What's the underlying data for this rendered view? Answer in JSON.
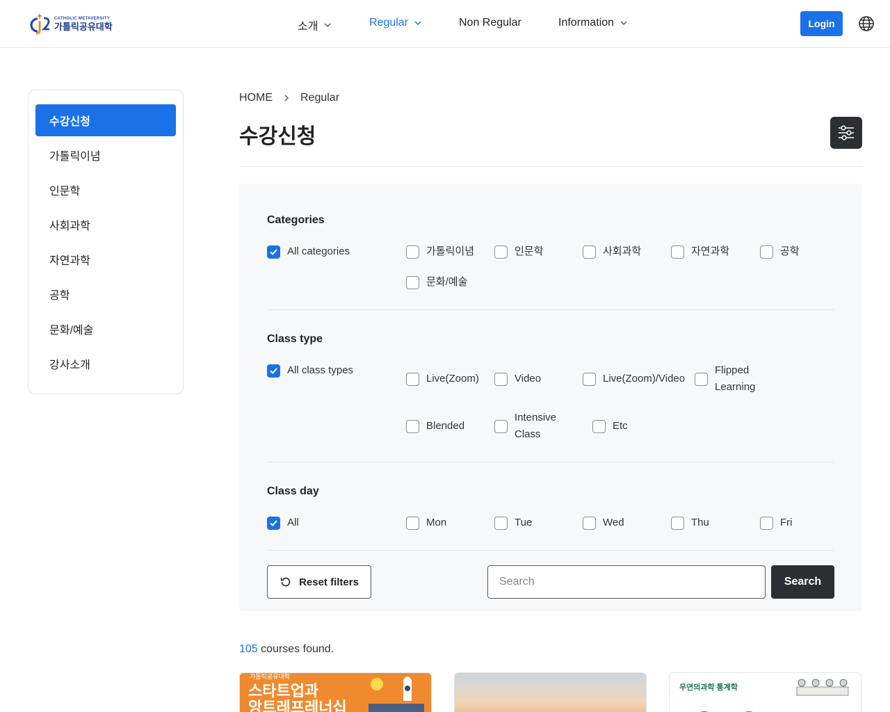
{
  "header": {
    "logo": {
      "tagline": "CATHOLIC METAVERSITY",
      "name": "가톨릭공유대학"
    },
    "nav": [
      {
        "label": "소개",
        "has_dropdown": true
      },
      {
        "label": "Regular",
        "has_dropdown": true,
        "active": true
      },
      {
        "label": "Non Regular",
        "has_dropdown": false
      },
      {
        "label": "Information",
        "has_dropdown": true
      }
    ],
    "login_label": "Login",
    "language_icon": "globe-icon"
  },
  "sidebar": {
    "items": [
      {
        "label": "수강신청",
        "active": true
      },
      {
        "label": "가톨릭이념"
      },
      {
        "label": "인문학"
      },
      {
        "label": "사회과학"
      },
      {
        "label": "자연과학"
      },
      {
        "label": "공학"
      },
      {
        "label": "문화/예술"
      },
      {
        "label": "강사소개"
      }
    ]
  },
  "breadcrumb": {
    "home": "HOME",
    "current": "Regular"
  },
  "page_title": "수강신청",
  "filters": {
    "categories": {
      "title": "Categories",
      "options": [
        {
          "label": "All categories",
          "checked": true
        },
        {
          "label": "가톨릭이념",
          "checked": false
        },
        {
          "label": "인문학",
          "checked": false
        },
        {
          "label": "사회과학",
          "checked": false
        },
        {
          "label": "자연과학",
          "checked": false
        },
        {
          "label": "공학",
          "checked": false
        },
        {
          "label": "문화/예술",
          "checked": false
        }
      ]
    },
    "class_type": {
      "title": "Class type",
      "options": [
        {
          "label": "All class types",
          "checked": true
        },
        {
          "label": "Live(Zoom)",
          "checked": false
        },
        {
          "label": "Video",
          "checked": false
        },
        {
          "label": "Live(Zoom)/Video",
          "checked": false
        },
        {
          "label": "Flipped Learning",
          "checked": false
        },
        {
          "label": "Blended",
          "checked": false
        },
        {
          "label": "Intensive Class",
          "checked": false
        },
        {
          "label": "Etc",
          "checked": false
        }
      ]
    },
    "class_day": {
      "title": "Class day",
      "options": [
        {
          "label": "All",
          "checked": true
        },
        {
          "label": "Mon",
          "checked": false
        },
        {
          "label": "Tue",
          "checked": false
        },
        {
          "label": "Wed",
          "checked": false
        },
        {
          "label": "Thu",
          "checked": false
        },
        {
          "label": "Fri",
          "checked": false
        }
      ]
    },
    "reset_label": "Reset filters",
    "search_placeholder": "Search",
    "search_label": "Search"
  },
  "results": {
    "count": "105",
    "suffix": " courses found."
  },
  "cards": [
    {
      "line_small": "가톨릭공유대학",
      "line1": "스타트업과",
      "line2": "앙트레프레너십"
    },
    {},
    {
      "title": "우연의과학 통계학"
    }
  ],
  "colors": {
    "primary": "#1b72e8",
    "dark": "#2b2f33",
    "panel": "#f7f8f9"
  }
}
